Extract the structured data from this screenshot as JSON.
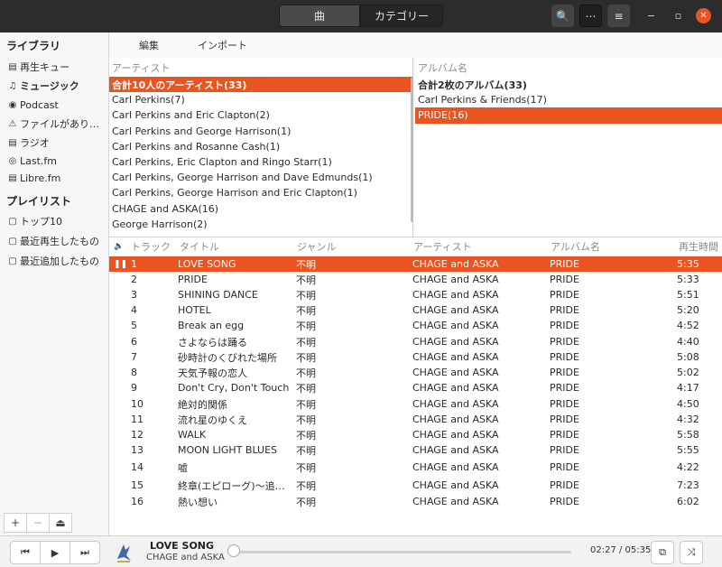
{
  "header": {
    "tabs": [
      {
        "label": "曲"
      },
      {
        "label": "カテゴリー"
      }
    ],
    "search_icon": "🔍",
    "more_icon": "⋯",
    "menu_icon": "≡",
    "minimize_icon": "−",
    "maximize_icon": "▫",
    "close_icon": "✕"
  },
  "sidebar": {
    "library_heading": "ライブラリ",
    "library_items": [
      {
        "icon": "▤",
        "label": "再生キュー",
        "active": false
      },
      {
        "icon": "♫",
        "label": "ミュージック",
        "active": true
      },
      {
        "icon": "◉",
        "label": "Podcast",
        "active": false
      },
      {
        "icon": "⚠",
        "label": "ファイルがあり…",
        "active": false
      },
      {
        "icon": "▤",
        "label": "ラジオ",
        "active": false
      },
      {
        "icon": "◎",
        "label": "Last.fm",
        "active": false
      },
      {
        "icon": "▤",
        "label": "Libre.fm",
        "active": false
      }
    ],
    "playlist_heading": "プレイリスト",
    "playlist_items": [
      {
        "icon": "▢",
        "label": "トップ10"
      },
      {
        "icon": "▢",
        "label": "最近再生したもの"
      },
      {
        "icon": "▢",
        "label": "最近追加したもの"
      }
    ],
    "tools": {
      "add": "+",
      "remove": "−",
      "eject": "⏏"
    }
  },
  "menubar": {
    "edit": "編集",
    "import": "インポート"
  },
  "artist_browser": {
    "header": "アーティスト",
    "items": [
      {
        "label": "合計10人のアーティスト(33)",
        "bold": true,
        "selected": true
      },
      {
        "label": "Carl Perkins(7)"
      },
      {
        "label": "Carl Perkins and Eric Clapton(2)"
      },
      {
        "label": "Carl Perkins and George Harrison(1)"
      },
      {
        "label": "Carl Perkins and Rosanne Cash(1)"
      },
      {
        "label": "Carl Perkins, Eric Clapton and Ringo Starr(1)"
      },
      {
        "label": "Carl Perkins, George Harrison and Dave Edmunds(1)"
      },
      {
        "label": "Carl Perkins, George Harrison and Eric Clapton(1)"
      },
      {
        "label": "CHAGE and ASKA(16)"
      },
      {
        "label": "George Harrison(2)"
      }
    ]
  },
  "album_browser": {
    "header": "アルバム名",
    "items": [
      {
        "label": "合計2枚のアルバム(33)",
        "bold": true,
        "selected": false
      },
      {
        "label": "Carl Perkins & Friends(17)"
      },
      {
        "label": "PRIDE(16)",
        "selected": true
      }
    ]
  },
  "track_table": {
    "columns": {
      "track": "トラック",
      "title": "タイトル",
      "genre": "ジャンル",
      "artist": "アーティスト",
      "album": "アルバム名",
      "length": "再生時間"
    },
    "speaker_icon": "🔈",
    "playing_icon": "❚❚",
    "rows": [
      {
        "no": "1",
        "title": "LOVE SONG",
        "genre": "不明",
        "artist": "CHAGE and ASKA",
        "album": "PRIDE",
        "length": "5:35",
        "playing": true
      },
      {
        "no": "2",
        "title": "PRIDE",
        "genre": "不明",
        "artist": "CHAGE and ASKA",
        "album": "PRIDE",
        "length": "5:33"
      },
      {
        "no": "3",
        "title": "SHINING DANCE",
        "genre": "不明",
        "artist": "CHAGE and ASKA",
        "album": "PRIDE",
        "length": "5:51"
      },
      {
        "no": "4",
        "title": "HOTEL",
        "genre": "不明",
        "artist": "CHAGE and ASKA",
        "album": "PRIDE",
        "length": "5:20"
      },
      {
        "no": "5",
        "title": "Break an egg",
        "genre": "不明",
        "artist": "CHAGE and ASKA",
        "album": "PRIDE",
        "length": "4:52"
      },
      {
        "no": "6",
        "title": "さよならは踊る",
        "genre": "不明",
        "artist": "CHAGE and ASKA",
        "album": "PRIDE",
        "length": "4:40"
      },
      {
        "no": "7",
        "title": "砂時計のくびれた場所",
        "genre": "不明",
        "artist": "CHAGE and ASKA",
        "album": "PRIDE",
        "length": "5:08"
      },
      {
        "no": "8",
        "title": "天気予報の恋人",
        "genre": "不明",
        "artist": "CHAGE and ASKA",
        "album": "PRIDE",
        "length": "5:02"
      },
      {
        "no": "9",
        "title": "Don't Cry, Don't Touch",
        "genre": "不明",
        "artist": "CHAGE and ASKA",
        "album": "PRIDE",
        "length": "4:17"
      },
      {
        "no": "10",
        "title": "絶対的関係",
        "genre": "不明",
        "artist": "CHAGE and ASKA",
        "album": "PRIDE",
        "length": "4:50"
      },
      {
        "no": "11",
        "title": "流れ星のゆくえ",
        "genre": "不明",
        "artist": "CHAGE and ASKA",
        "album": "PRIDE",
        "length": "4:32"
      },
      {
        "no": "12",
        "title": "WALK",
        "genre": "不明",
        "artist": "CHAGE and ASKA",
        "album": "PRIDE",
        "length": "5:58"
      },
      {
        "no": "13",
        "title": "MOON LIGHT BLUES",
        "genre": "不明",
        "artist": "CHAGE and ASKA",
        "album": "PRIDE",
        "length": "5:55"
      },
      {
        "no": "14",
        "title": "嘘",
        "genre": "不明",
        "artist": "CHAGE and ASKA",
        "album": "PRIDE",
        "length": "4:22"
      },
      {
        "no": "15",
        "title": "終章(エピローグ)〜追…",
        "genre": "不明",
        "artist": "CHAGE and ASKA",
        "album": "PRIDE",
        "length": "7:23"
      },
      {
        "no": "16",
        "title": "熱い想い",
        "genre": "不明",
        "artist": "CHAGE and ASKA",
        "album": "PRIDE",
        "length": "6:02"
      }
    ]
  },
  "player": {
    "prev_icon": "⏮",
    "play_icon": "▶",
    "next_icon": "⏭",
    "now_playing_title": "LOVE SONG",
    "now_playing_artist": "CHAGE and ASKA",
    "time": "02:27 / 05:35",
    "progress_fraction": 0.0,
    "repeat_icon": "⧉",
    "shuffle_icon": "⤨",
    "accent_color": "#e95420"
  }
}
